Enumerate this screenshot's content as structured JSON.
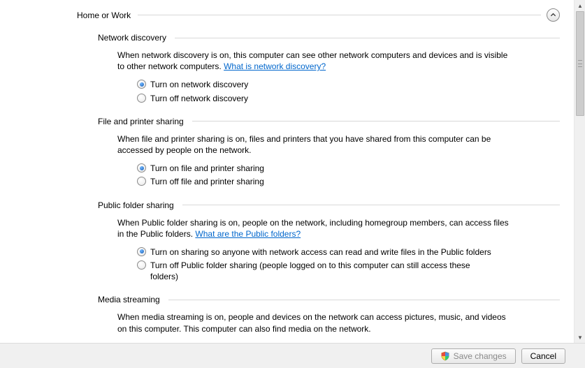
{
  "profile": {
    "title": "Home or Work"
  },
  "sections": {
    "network_discovery": {
      "title": "Network discovery",
      "desc_before": "When network discovery is on, this computer can see other network computers and devices and is visible to other network computers. ",
      "link": "What is network discovery?",
      "options": {
        "on": "Turn on network discovery",
        "off": "Turn off network discovery"
      }
    },
    "file_printer": {
      "title": "File and printer sharing",
      "desc": "When file and printer sharing is on, files and printers that you have shared from this computer can be accessed by people on the network.",
      "options": {
        "on": "Turn on file and printer sharing",
        "off": "Turn off file and printer sharing"
      }
    },
    "public_folder": {
      "title": "Public folder sharing",
      "desc_before": "When Public folder sharing is on, people on the network, including homegroup members, can access files in the Public folders. ",
      "link": "What are the Public folders?",
      "options": {
        "on": "Turn on sharing so anyone with network access can read and write files in the Public folders",
        "off": "Turn off Public folder sharing (people logged on to this computer can still access these folders)"
      }
    },
    "media_streaming": {
      "title": "Media streaming",
      "desc": "When media streaming is on, people and devices on the network can access pictures, music, and videos on this computer. This computer can also find media on the network."
    }
  },
  "footer": {
    "save": "Save changes",
    "cancel": "Cancel"
  }
}
